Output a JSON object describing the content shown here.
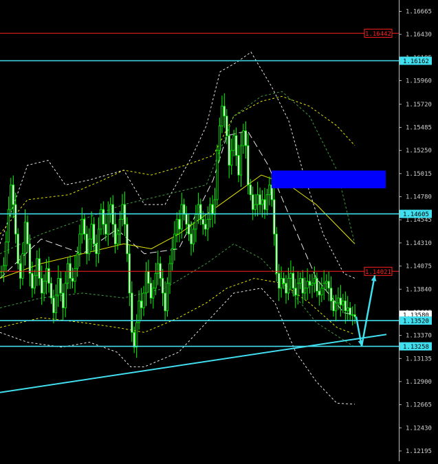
{
  "chart_data": {
    "type": "line",
    "title": "",
    "xlabel": "",
    "ylabel": "",
    "ylim": [
      1.1209,
      1.1678
    ],
    "grid": false,
    "colors": {
      "background": "#000000",
      "axis": "#c0c0c0",
      "candle_bull": "#00ff00",
      "candle_bear": "#ffffff",
      "level_red": "#ff2020",
      "level_cyan": "#40e0f0",
      "zone_blue": "#0000ff",
      "band_white": "#e8e8e8",
      "band_yellow": "#e8e800",
      "band_green": "#40a040"
    },
    "y_ticks": [
      {
        "label": "1.16665",
        "value": 1.16665
      },
      {
        "label": "1.16430",
        "value": 1.1643
      },
      {
        "label": "1.16195",
        "value": 1.16195
      },
      {
        "label": "1.15960",
        "value": 1.1596
      },
      {
        "label": "1.15720",
        "value": 1.1572
      },
      {
        "label": "1.15485",
        "value": 1.15485
      },
      {
        "label": "1.15250",
        "value": 1.1525
      },
      {
        "label": "1.15015",
        "value": 1.15015
      },
      {
        "label": "1.14780",
        "value": 1.1478
      },
      {
        "label": "1.14545",
        "value": 1.14545
      },
      {
        "label": "1.14310",
        "value": 1.1431
      },
      {
        "label": "1.14075",
        "value": 1.14075
      },
      {
        "label": "1.13840",
        "value": 1.1384
      },
      {
        "label": "1.13605",
        "value": 1.13605
      },
      {
        "label": "1.13370",
        "value": 1.1337
      },
      {
        "label": "1.13135",
        "value": 1.13135
      },
      {
        "label": "1.12900",
        "value": 1.129
      },
      {
        "label": "1.12665",
        "value": 1.12665
      },
      {
        "label": "1.12430",
        "value": 1.1243
      },
      {
        "label": "1.12195",
        "value": 1.12195
      }
    ],
    "levels": [
      {
        "name": "",
        "label": "1.16442",
        "value": 1.16442,
        "color": "#ff2020",
        "style": "red-box"
      },
      {
        "name": "",
        "label": "1.16162",
        "value": 1.16162,
        "color": "#40e0f0",
        "style": "cyan-filled"
      },
      {
        "name": "",
        "label": "1.14605",
        "value": 1.14605,
        "color": "#40e0f0",
        "style": "cyan-filled"
      },
      {
        "name": "",
        "label": "1.14021",
        "value": 1.14021,
        "color": "#ff2020",
        "style": "red-box"
      },
      {
        "name": "",
        "label": "1.13520",
        "value": 1.1352,
        "color": "#40e0f0",
        "style": "cyan-filled"
      },
      {
        "name": "",
        "label": "1.13258",
        "value": 1.13258,
        "color": "#40e0f0",
        "style": "cyan-filled"
      }
    ],
    "price_tag": {
      "label": "1.13580",
      "value": 1.1358
    },
    "trendline": {
      "x": [
        0,
        562
      ],
      "y": [
        1.1279,
        1.1338
      ]
    },
    "zone": {
      "x": [
        395,
        561
      ],
      "y_top": 1.15046,
      "y_bottom": 1.14866
    },
    "arrows": [
      {
        "x": [
          518,
          526
        ],
        "y": [
          1.1356,
          1.1326
        ]
      },
      {
        "x": [
          526,
          545
        ],
        "y": [
          1.1326,
          1.1398
        ]
      }
    ],
    "candles": {
      "x_start": 2,
      "x_step": 3.45,
      "close": [
        1.1402,
        1.1408,
        1.1432,
        1.1465,
        1.149,
        1.147,
        1.144,
        1.141,
        1.1395,
        1.142,
        1.1452,
        1.143,
        1.14,
        1.1385,
        1.1398,
        1.1415,
        1.1395,
        1.138,
        1.1392,
        1.1405,
        1.139,
        1.1375,
        1.136,
        1.1378,
        1.1395,
        1.138,
        1.1365,
        1.139,
        1.141,
        1.1395,
        1.1392,
        1.1405,
        1.142,
        1.144,
        1.1455,
        1.144,
        1.142,
        1.1435,
        1.145,
        1.143,
        1.142,
        1.1445,
        1.1465,
        1.145,
        1.144,
        1.146,
        1.147,
        1.145,
        1.143,
        1.144,
        1.1455,
        1.147,
        1.145,
        1.142,
        1.138,
        1.134,
        1.1325,
        1.135,
        1.1372,
        1.1365,
        1.138,
        1.1402,
        1.139,
        1.1375,
        1.1385,
        1.14,
        1.141,
        1.1395,
        1.138,
        1.1362,
        1.139,
        1.141,
        1.1425,
        1.144,
        1.1455,
        1.1445,
        1.147,
        1.146,
        1.145,
        1.144,
        1.143,
        1.1445,
        1.146,
        1.147,
        1.1455,
        1.145,
        1.1445,
        1.1455,
        1.147,
        1.146,
        1.1475,
        1.1525,
        1.155,
        1.157,
        1.156,
        1.154,
        1.151,
        1.1525,
        1.154,
        1.152,
        1.15,
        1.153,
        1.1545,
        1.153,
        1.149,
        1.148,
        1.1465,
        1.147,
        1.148,
        1.147,
        1.1475,
        1.1465,
        1.148,
        1.149,
        1.1475,
        1.144,
        1.14,
        1.1385,
        1.1395,
        1.139,
        1.138,
        1.1395,
        1.14,
        1.1385,
        1.1378,
        1.139,
        1.1395,
        1.138,
        1.1385,
        1.1392,
        1.1388,
        1.139,
        1.1395,
        1.1382,
        1.1378,
        1.1385,
        1.139,
        1.1392,
        1.1385,
        1.1372,
        1.1362,
        1.137,
        1.1375,
        1.1368,
        1.1372,
        1.1362,
        1.1365,
        1.1358,
        1.1358,
        1.1356
      ]
    },
    "bands": [
      {
        "name": "",
        "color": "#e8e8e8",
        "dash": "3,3",
        "x": [
          0,
          40,
          70,
          95,
          130,
          180,
          210,
          240,
          280,
          300,
          320,
          345,
          365,
          395,
          420,
          440,
          470,
          500,
          516
        ],
        "y": [
          1.143,
          1.151,
          1.1515,
          1.149,
          1.1495,
          1.1505,
          1.147,
          1.147,
          1.152,
          1.155,
          1.1605,
          1.1615,
          1.1625,
          1.159,
          1.1555,
          1.1505,
          1.144,
          1.14,
          1.1395
        ]
      },
      {
        "name": "",
        "color": "#e8e8e8",
        "dash": "3,3",
        "x": [
          0,
          40,
          90,
          130,
          170,
          190,
          210,
          260,
          300,
          340,
          380,
          400,
          430,
          460,
          490,
          516
        ],
        "y": [
          1.134,
          1.133,
          1.1325,
          1.133,
          1.132,
          1.1305,
          1.1305,
          1.132,
          1.135,
          1.138,
          1.1385,
          1.137,
          1.132,
          1.129,
          1.1268,
          1.1267
        ]
      },
      {
        "name": "",
        "color": "#e8e8e8",
        "dash": "10,5",
        "x": [
          0,
          60,
          120,
          170,
          210,
          260,
          310,
          330,
          360,
          390,
          420,
          460,
          500,
          516
        ],
        "y": [
          1.1395,
          1.1435,
          1.142,
          1.1445,
          1.142,
          1.1425,
          1.1495,
          1.154,
          1.1545,
          1.151,
          1.146,
          1.1395,
          1.136,
          1.1358
        ]
      },
      {
        "name": "",
        "color": "#e8e800",
        "dash": "3,3",
        "x": [
          0,
          40,
          100,
          150,
          180,
          220,
          270,
          310,
          340,
          380,
          410,
          450,
          490,
          516
        ],
        "y": [
          1.144,
          1.1475,
          1.148,
          1.1495,
          1.1505,
          1.15,
          1.151,
          1.152,
          1.156,
          1.1575,
          1.158,
          1.157,
          1.155,
          1.153
        ]
      },
      {
        "name": "",
        "color": "#e8e800",
        "dash": "3,3",
        "x": [
          0,
          60,
          120,
          170,
          210,
          260,
          300,
          330,
          370,
          410,
          450,
          490,
          516
        ],
        "y": [
          1.1345,
          1.1355,
          1.135,
          1.1345,
          1.134,
          1.1355,
          1.137,
          1.1385,
          1.1395,
          1.139,
          1.137,
          1.1345,
          1.1338
        ]
      },
      {
        "name": "",
        "color": "#e8e800",
        "dash": "",
        "x": [
          0,
          60,
          120,
          180,
          220,
          260,
          300,
          340,
          380,
          420,
          460,
          516
        ],
        "y": [
          1.1395,
          1.141,
          1.142,
          1.143,
          1.1425,
          1.144,
          1.146,
          1.148,
          1.15,
          1.149,
          1.147,
          1.143
        ]
      },
      {
        "name": "",
        "color": "#40a040",
        "dash": "3,3",
        "x": [
          0,
          60,
          120,
          180,
          240,
          300,
          340,
          380,
          410,
          450,
          490,
          516
        ],
        "y": [
          1.142,
          1.144,
          1.1455,
          1.147,
          1.148,
          1.149,
          1.156,
          1.158,
          1.1585,
          1.156,
          1.1505,
          1.143
        ]
      },
      {
        "name": "",
        "color": "#40a040",
        "dash": "3,3",
        "x": [
          0,
          60,
          120,
          180,
          240,
          300,
          340,
          380,
          420,
          460,
          516
        ],
        "y": [
          1.1365,
          1.1375,
          1.138,
          1.1375,
          1.1385,
          1.141,
          1.143,
          1.1415,
          1.1385,
          1.135,
          1.1325
        ]
      }
    ]
  }
}
